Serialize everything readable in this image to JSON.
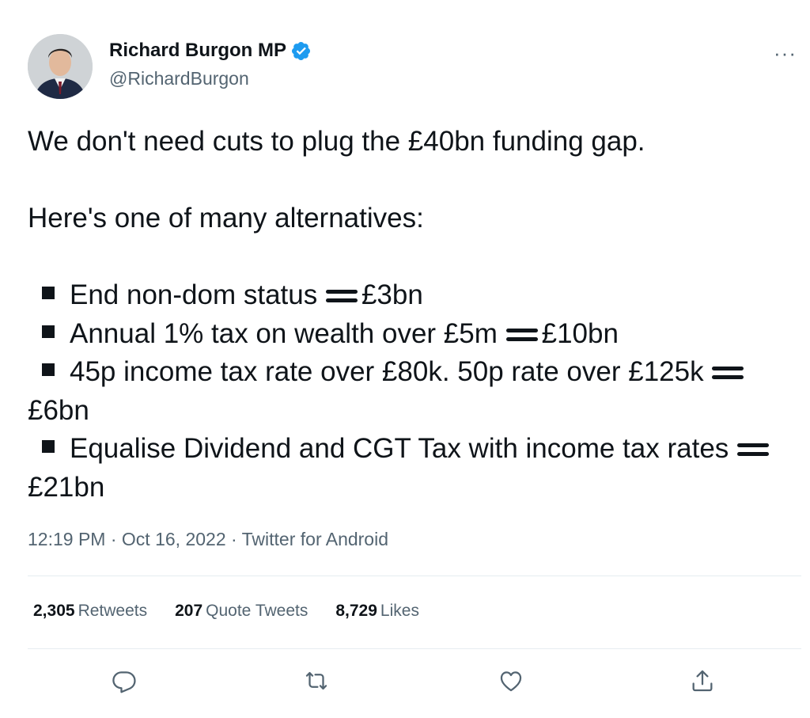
{
  "author": {
    "name": "Richard Burgon MP",
    "handle": "@RichardBurgon",
    "verified_icon": "verified-badge-icon"
  },
  "more_label": "···",
  "tweet": {
    "line1": "We don't need cuts to plug the £40bn funding gap.",
    "line2": "Here's one of many alternatives:",
    "bullets": [
      {
        "text": "End non-dom status ",
        "value": "£3bn"
      },
      {
        "text": "Annual 1% tax on wealth over £5m ",
        "value": "£10bn"
      },
      {
        "text": "45p income tax rate over £80k. 50p rate over £125k ",
        "value": "£6bn"
      },
      {
        "text": "Equalise Dividend and CGT Tax with income tax rates ",
        "value": "£21bn"
      }
    ]
  },
  "meta": {
    "time": "12:19 PM",
    "date": "Oct 16, 2022",
    "source": "Twitter for Android"
  },
  "stats": {
    "retweets_count": "2,305",
    "retweets_label": "Retweets",
    "quotes_count": "207",
    "quotes_label": "Quote Tweets",
    "likes_count": "8,729",
    "likes_label": "Likes"
  },
  "actions": [
    "reply-icon",
    "retweet-icon",
    "like-icon",
    "share-icon"
  ],
  "colors": {
    "text": "#0f1419",
    "secondary": "#536471",
    "verified": "#1d9bf0",
    "divider": "#e6ecf0"
  }
}
